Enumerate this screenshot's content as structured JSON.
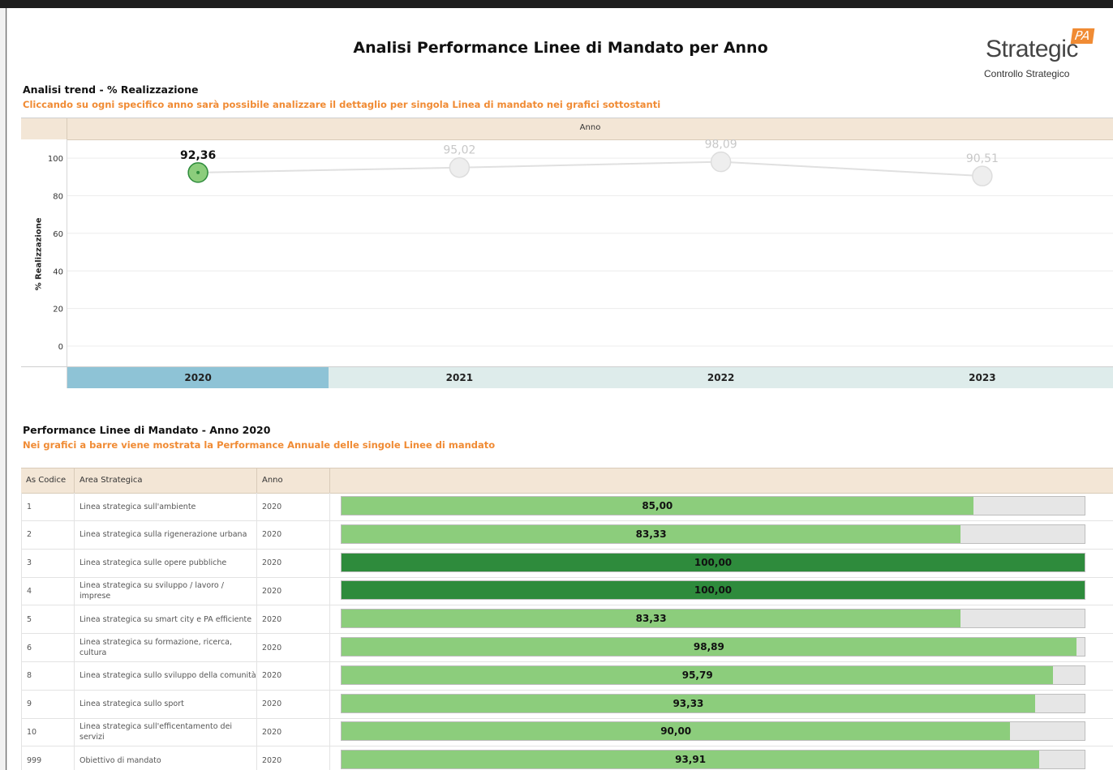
{
  "page": {
    "title": "Analisi Performance Linee di Mandato per Anno",
    "logo": {
      "word": "Strategic",
      "badge": "PA",
      "subtitle": "Controllo Strategico"
    }
  },
  "trend_section": {
    "title": "Analisi trend - % Realizzazione",
    "subtitle": "Cliccando su ogni specifico anno sarà possibile analizzare il dettaglio per singola Linea di mandato nei grafici sottostanti",
    "header": "Anno",
    "selected_year": "2020"
  },
  "bars_section": {
    "title": "Performance Linee di Mandato - Anno 2020",
    "subtitle": "Nei grafici a barre viene mostrata la Performance Annuale delle singole Linee di mandato",
    "columns": [
      "As Codice",
      "Area Strategica",
      "Anno"
    ]
  },
  "colors": {
    "header_bg": "#f3e6d6",
    "accent_orange": "#f08b34",
    "selected_year_bg": "#8ec3d6",
    "year_bg": "#deeceb",
    "bar_light_green": "#8ccd7c",
    "bar_dark_green": "#2e8b3c",
    "bar_track": "#e6e6e6"
  },
  "chart_data": [
    {
      "type": "line",
      "x": [
        "2020",
        "2021",
        "2022",
        "2023"
      ],
      "series": [
        {
          "values": [
            92.36,
            95.02,
            98.09,
            90.51
          ],
          "labels": [
            "92,36",
            "95,02",
            "98,09",
            "90,51"
          ]
        }
      ],
      "ylabel": "% Realizzazione",
      "ylim": [
        0,
        110
      ],
      "yticks": [
        0,
        20,
        40,
        60,
        80,
        100
      ],
      "highlighted": "2020",
      "grid": true
    },
    {
      "type": "bar",
      "orientation": "horizontal",
      "xlim": [
        0,
        100
      ],
      "rows": [
        {
          "code": "1",
          "area": "Linea strategica sull'ambiente",
          "year": "2020",
          "value": 85.0,
          "label": "85,00"
        },
        {
          "code": "2",
          "area": "Linea strategica sulla rigenerazione urbana",
          "year": "2020",
          "value": 83.33,
          "label": "83,33"
        },
        {
          "code": "3",
          "area": "Linea strategica sulle opere pubbliche",
          "year": "2020",
          "value": 100.0,
          "label": "100,00"
        },
        {
          "code": "4",
          "area": "Linea strategica su sviluppo / lavoro / imprese",
          "year": "2020",
          "value": 100.0,
          "label": "100,00"
        },
        {
          "code": "5",
          "area": "Linea strategica su smart city e PA efficiente",
          "year": "2020",
          "value": 83.33,
          "label": "83,33"
        },
        {
          "code": "6",
          "area": "Linea strategica su formazione, ricerca, cultura",
          "year": "2020",
          "value": 98.89,
          "label": "98,89"
        },
        {
          "code": "8",
          "area": "Linea strategica sullo sviluppo della comunità",
          "year": "2020",
          "value": 95.79,
          "label": "95,79"
        },
        {
          "code": "9",
          "area": "Linea strategica sullo sport",
          "year": "2020",
          "value": 93.33,
          "label": "93,33"
        },
        {
          "code": "10",
          "area": "Linea strategica sull'efficentamento dei servizi",
          "year": "2020",
          "value": 90.0,
          "label": "90,00"
        },
        {
          "code": "999",
          "area": "Obiettivo di mandato",
          "year": "2020",
          "value": 93.91,
          "label": "93,91"
        }
      ]
    }
  ]
}
